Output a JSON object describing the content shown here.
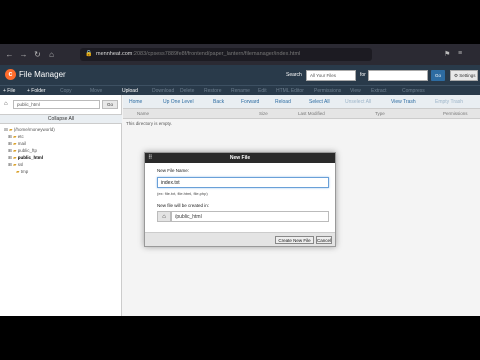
{
  "browser": {
    "url_domain": "mennheat.com",
    "url_path": ":2083/cpsess7889fe8f/frontend/paper_lantern/filemanager/index.html"
  },
  "header": {
    "app_title": "File Manager",
    "search_label": "Search",
    "search_select": "All Your Files",
    "for_label": "for",
    "go_label": "Go",
    "settings_label": "⚙ Settings"
  },
  "toolbar": {
    "items": [
      "+ File",
      "+ Folder",
      "Copy",
      "Move",
      "Upload",
      "Download",
      "Delete",
      "Restore",
      "Rename",
      "Edit",
      "HTML Editor",
      "Permissions",
      "View",
      "Extract",
      "Compress"
    ]
  },
  "sidebar": {
    "path": "public_html",
    "go_label": "Go",
    "collapse_label": "Collapse All",
    "tree": [
      {
        "prefix": "⊟ ",
        "label": "(/home/moneyworld)",
        "indent": 0
      },
      {
        "prefix": "⊞ ",
        "label": "etc",
        "indent": 1
      },
      {
        "prefix": "⊞ ",
        "label": "mail",
        "indent": 1
      },
      {
        "prefix": "⊞ ",
        "label": "public_ftp",
        "indent": 1
      },
      {
        "prefix": "⊞ ",
        "label": "public_html",
        "indent": 1
      },
      {
        "prefix": "⊞ ",
        "label": "ssl",
        "indent": 1
      },
      {
        "prefix": "",
        "label": "tmp",
        "indent": 2
      }
    ]
  },
  "right_toolbar": {
    "items": [
      "Home",
      "Up One Level",
      "Back",
      "Forward",
      "Reload",
      "Select All",
      "Unselect All",
      "View Trash",
      "Empty Trash"
    ]
  },
  "columns": [
    "Name",
    "Size",
    "Last Modified",
    "Type",
    "Permissions"
  ],
  "empty_message": "This directory is empty.",
  "modal": {
    "title": "New File",
    "label_name": "New File Name:",
    "file_name": "index.txt",
    "hint": "(ex: file.txt, file.html, file.php)",
    "label_dir": "New file will be created in:",
    "directory": "/public_html",
    "create_label": "Create New File",
    "cancel_label": "Cancel"
  }
}
